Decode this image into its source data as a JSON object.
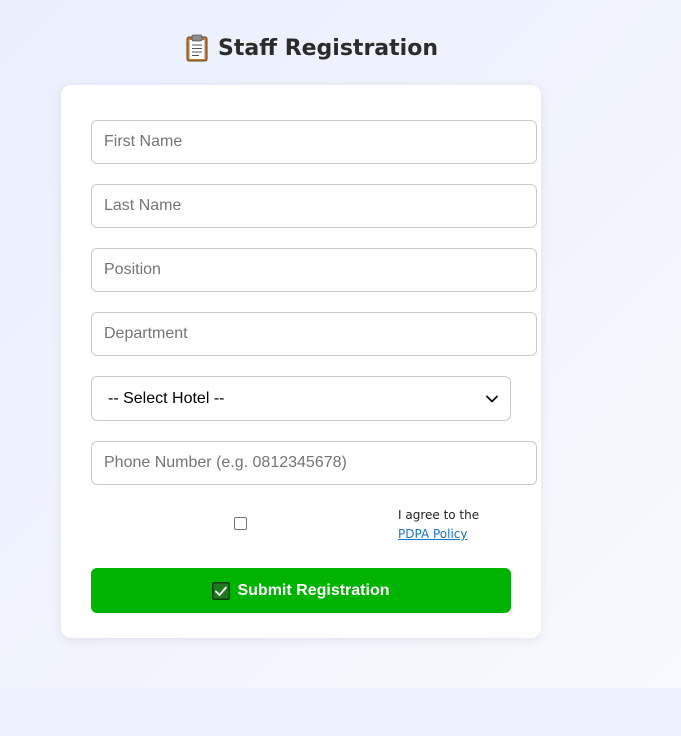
{
  "page": {
    "title": "Staff Registration",
    "title_icon": "clipboard-icon"
  },
  "form": {
    "first_name_placeholder": "First Name",
    "last_name_placeholder": "Last Name",
    "position_placeholder": "Position",
    "department_placeholder": "Department",
    "hotel_select_value": "-- Select Hotel --",
    "phone_placeholder": "Phone Number (e.g. 0812345678)",
    "agree_prefix": "I agree to the",
    "pdpa_link_label": "PDPA Policy",
    "agree_checked": false,
    "submit_label": "Submit Registration",
    "submit_icon": "check-icon"
  },
  "colors": {
    "submit_bg": "#00b300",
    "link": "#1a73c8",
    "background": "#eef2fd"
  }
}
